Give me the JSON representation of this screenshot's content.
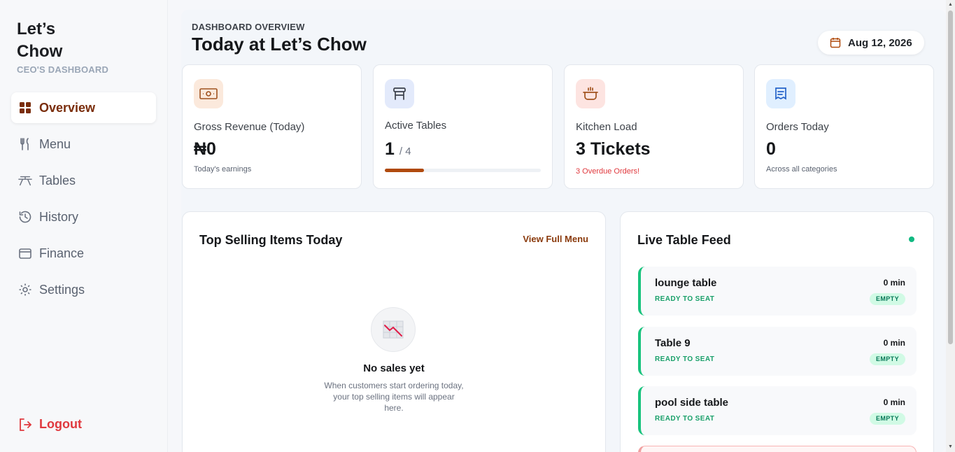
{
  "brand": {
    "name_line1": "Let’s",
    "name_line2": "Chow",
    "subtitle": "CEO'S DASHBOARD"
  },
  "nav": [
    {
      "label": "Overview",
      "icon": "grid-icon",
      "active": true
    },
    {
      "label": "Menu",
      "icon": "fork-knife-icon"
    },
    {
      "label": "Tables",
      "icon": "table-icon"
    },
    {
      "label": "History",
      "icon": "history-icon"
    },
    {
      "label": "Finance",
      "icon": "wallet-icon"
    },
    {
      "label": "Settings",
      "icon": "gear-icon"
    }
  ],
  "logout_label": "Logout",
  "header": {
    "overline": "DASHBOARD OVERVIEW",
    "title": "Today at Let’s Chow",
    "date": "Aug 12, 2026"
  },
  "stats": {
    "revenue": {
      "label": "Gross Revenue (Today)",
      "value": "₦0",
      "sub": "Today's earnings",
      "icon": "cash-icon"
    },
    "tables": {
      "label": "Active Tables",
      "value": "1",
      "total": "/ 4",
      "progress": 0.25,
      "icon": "chair-icon"
    },
    "kitchen": {
      "label": "Kitchen Load",
      "value": "3 Tickets",
      "sub": "3 Overdue Orders!",
      "icon": "pot-icon"
    },
    "orders": {
      "label": "Orders Today",
      "value": "0",
      "sub": "Across all categories",
      "icon": "receipt-icon"
    }
  },
  "top_selling": {
    "title": "Top Selling Items Today",
    "link": "View Full Menu",
    "empty_title": "No sales yet",
    "empty_desc": "When customers start ordering today, your top selling items will appear here."
  },
  "live_feed": {
    "title": "Live Table Feed",
    "items": [
      {
        "name": "lounge table",
        "status": "READY TO SEAT",
        "time": "0 min",
        "badge": "EMPTY"
      },
      {
        "name": "Table 9",
        "status": "READY TO SEAT",
        "time": "0 min",
        "badge": "EMPTY"
      },
      {
        "name": "pool side table",
        "status": "READY TO SEAT",
        "time": "0 min",
        "badge": "EMPTY"
      }
    ]
  },
  "colors": {
    "accent": "#7a2d0c",
    "progress": "#b04a0d",
    "danger": "#e0393e",
    "success": "#19c37d"
  }
}
